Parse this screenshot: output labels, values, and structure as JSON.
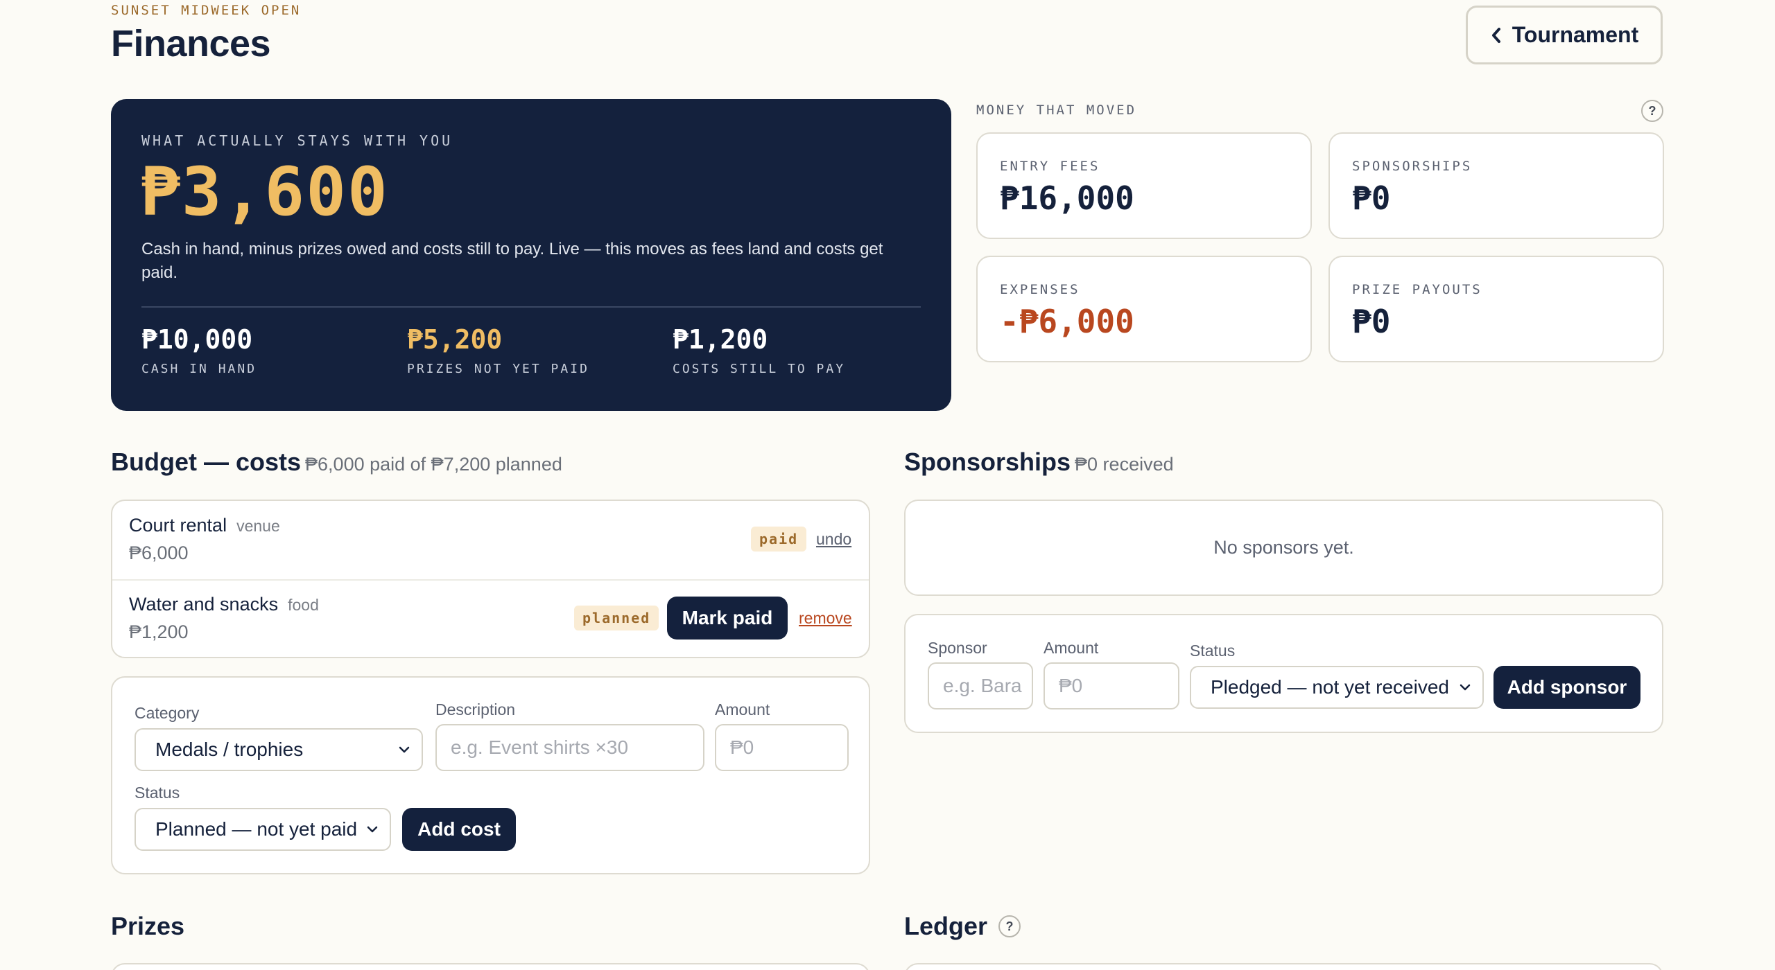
{
  "header": {
    "eyebrow": "SUNSET MIDWEEK OPEN",
    "title": "Finances",
    "back_button": "Tournament"
  },
  "hero": {
    "eyebrow": "WHAT ACTUALLY STAYS WITH YOU",
    "value": "₱3,600",
    "description": "Cash in hand, minus prizes owed and costs still to pay. Live — this moves as fees land and costs get paid.",
    "stats": [
      {
        "value": "₱10,000",
        "label": "CASH IN HAND"
      },
      {
        "value": "₱5,200",
        "label": "PRIZES NOT YET PAID"
      },
      {
        "value": "₱1,200",
        "label": "COSTS STILL TO PAY"
      }
    ]
  },
  "money_moved": {
    "eyebrow": "MONEY THAT MOVED",
    "help": "?",
    "cards": [
      {
        "label": "ENTRY FEES",
        "value": "₱16,000"
      },
      {
        "label": "SPONSORSHIPS",
        "value": "₱0"
      },
      {
        "label": "EXPENSES",
        "value": "-₱6,000"
      },
      {
        "label": "PRIZE PAYOUTS",
        "value": "₱0"
      }
    ]
  },
  "budget": {
    "title": "Budget — costs",
    "subtitle": "₱6,000 paid of ₱7,200 planned",
    "rows": [
      {
        "name": "Court rental",
        "tag": "venue",
        "amount": "₱6,000",
        "status": "paid",
        "action": "undo"
      },
      {
        "name": "Water and snacks",
        "tag": "food",
        "amount": "₱1,200",
        "status": "planned",
        "mark_paid": "Mark paid",
        "action": "remove"
      }
    ],
    "form": {
      "category_label": "Category",
      "category_value": "Medals / trophies",
      "description_label": "Description",
      "description_placeholder": "e.g. Event shirts ×30",
      "amount_label": "Amount",
      "amount_placeholder": "₱0",
      "status_label": "Status",
      "status_value": "Planned — not yet paid",
      "submit": "Add cost"
    }
  },
  "sponsorships": {
    "title": "Sponsorships",
    "subtitle": "₱0 received",
    "empty": "No sponsors yet.",
    "form": {
      "sponsor_label": "Sponsor",
      "sponsor_placeholder": "e.g. Bara",
      "amount_label": "Amount",
      "amount_placeholder": "₱0",
      "status_label": "Status",
      "status_value": "Pledged — not yet received",
      "submit": "Add sponsor"
    }
  },
  "prizes": {
    "title": "Prizes"
  },
  "ledger": {
    "title": "Ledger",
    "help": "?"
  },
  "colors": {
    "navy": "#14213d",
    "gold": "#f0bd63",
    "expense_red": "#b9471f",
    "background": "#fcfbf6"
  }
}
